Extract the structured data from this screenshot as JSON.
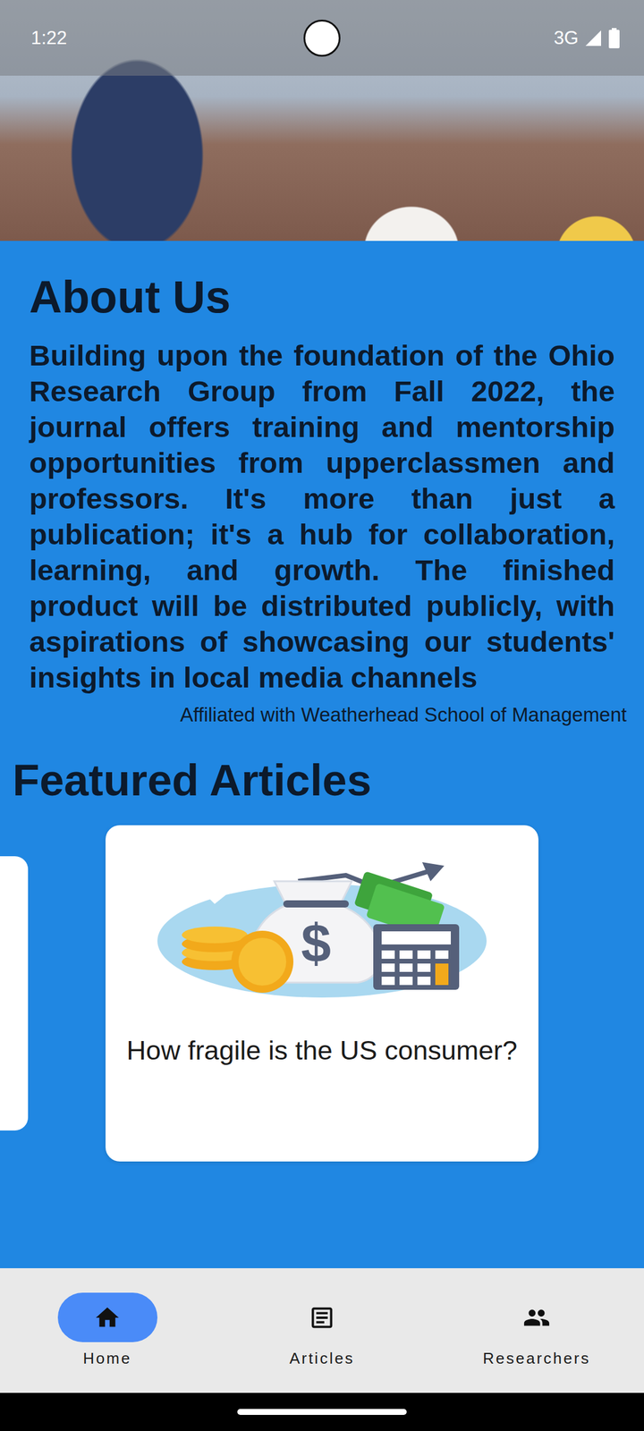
{
  "status_bar": {
    "time": "1:22",
    "network": "3G"
  },
  "about": {
    "title": "About Us",
    "body": "Building upon the foundation of the Ohio Research Group from Fall 2022, the journal offers training and mentorship opportunities from upperclassmen and professors. It's more than just a publication; it's a hub for collaboration, learning, and growth. The finished product will be distributed publicly, with aspirations of showcasing our students' insights in local media channels",
    "affiliation": "Affiliated with Weatherhead School of Management"
  },
  "featured": {
    "title": "Featured Articles",
    "articles": [
      {
        "title": "How fragile is the US consumer?",
        "selected": true
      }
    ]
  },
  "nav": [
    {
      "label": "Home",
      "icon": "home",
      "selected": true
    },
    {
      "label": "Articles",
      "icon": "article",
      "selected": false
    },
    {
      "label": "Researchers",
      "icon": "people",
      "selected": false
    }
  ]
}
